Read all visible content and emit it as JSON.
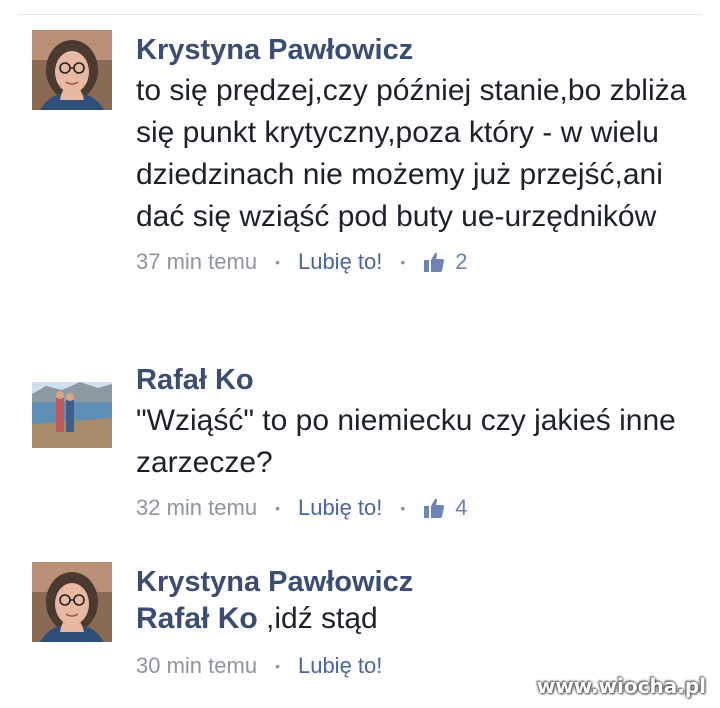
{
  "comments": [
    {
      "author": "Krystyna Pawłowicz",
      "text": "to się prędzej,czy później stanie,bo zbliża się punkt krytyczny,poza który - w wielu dziedzinach nie możemy już przejść,ani dać się wziąść  pod buty ue-urzędników",
      "time": "37 min temu",
      "like_label": "Lubię to!",
      "likes": "2",
      "avatar_icon": "profile-photo-woman-glasses"
    },
    {
      "author": "Rafał Ko",
      "text": "\"Wziąść\" to po niemiecku czy jakieś inne zarzecze?",
      "time": "32 min temu",
      "like_label": "Lubię to!",
      "likes": "4",
      "avatar_icon": "profile-photo-couple-by-sea"
    },
    {
      "author": "Krystyna Pawłowicz",
      "mention": "Rafał Ko",
      "text": " ,idź stąd",
      "time": "30 min temu",
      "like_label": "Lubię to!",
      "avatar_icon": "profile-photo-woman-glasses"
    }
  ],
  "separator": "•",
  "watermark": "www.wiocha.pl",
  "colors": {
    "author": "#3b4d73",
    "text": "#1d2129",
    "meta": "#90949c",
    "like": "#4b67a1"
  }
}
